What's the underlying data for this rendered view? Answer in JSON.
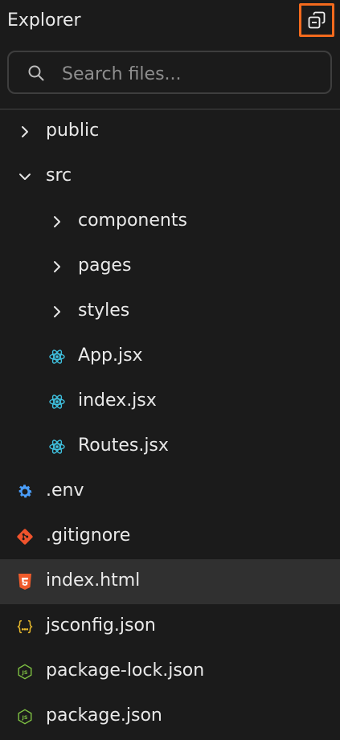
{
  "panel": {
    "title": "Explorer",
    "collapse_icon": "collapse-all-icon"
  },
  "search": {
    "placeholder": "Search files...",
    "value": "",
    "icon": "search-icon"
  },
  "tree": [
    {
      "label": "public",
      "type": "folder",
      "expanded": false,
      "level": 0
    },
    {
      "label": "src",
      "type": "folder",
      "expanded": true,
      "level": 0
    },
    {
      "label": "components",
      "type": "folder",
      "expanded": false,
      "level": 1
    },
    {
      "label": "pages",
      "type": "folder",
      "expanded": false,
      "level": 1
    },
    {
      "label": "styles",
      "type": "folder",
      "expanded": false,
      "level": 1
    },
    {
      "label": "App.jsx",
      "type": "react-file",
      "level": 1
    },
    {
      "label": "index.jsx",
      "type": "react-file",
      "level": 1
    },
    {
      "label": "Routes.jsx",
      "type": "react-file",
      "level": 1
    },
    {
      "label": ".env",
      "type": "env-file",
      "level": 0
    },
    {
      "label": ".gitignore",
      "type": "git-file",
      "level": 0
    },
    {
      "label": "index.html",
      "type": "html-file",
      "level": 0,
      "selected": true
    },
    {
      "label": "jsconfig.json",
      "type": "json-file",
      "level": 0
    },
    {
      "label": "package-lock.json",
      "type": "node-file",
      "level": 0
    },
    {
      "label": "package.json",
      "type": "node-file",
      "level": 0
    }
  ],
  "colors": {
    "background": "#1b1b1b",
    "selected_row": "#303030",
    "focus_outline": "#f36a1d",
    "react": "#3fc1df",
    "env": "#4a9df8",
    "git": "#f0532c",
    "html": "#ef5b2b",
    "json": "#e5b72b",
    "node": "#7fc243"
  }
}
